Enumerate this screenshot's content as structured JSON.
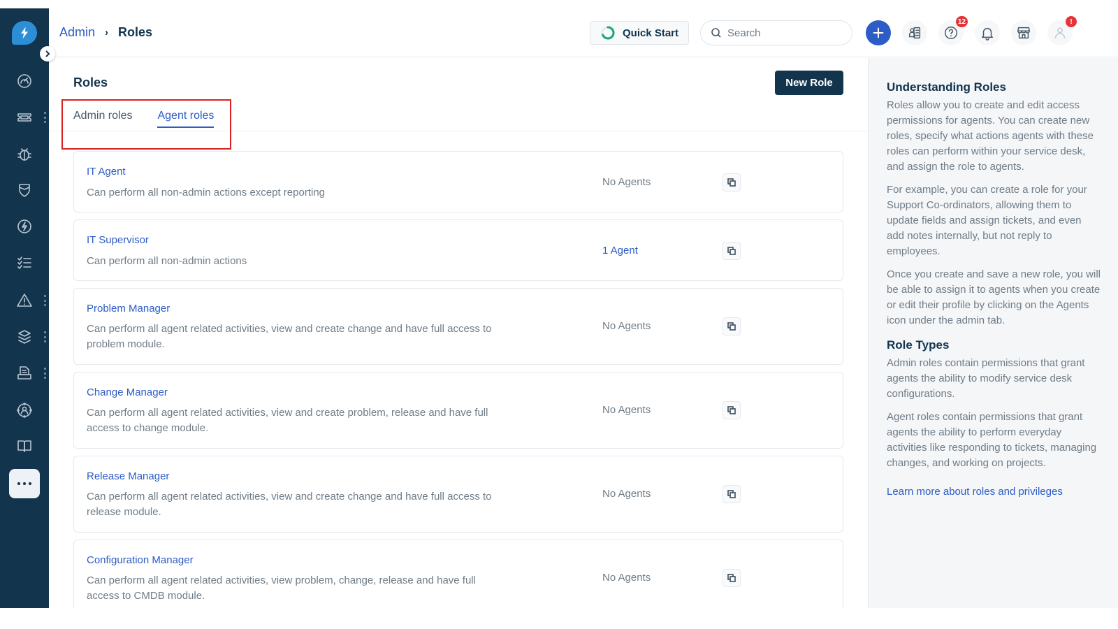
{
  "breadcrumb": {
    "parent": "Admin",
    "current": "Roles"
  },
  "header": {
    "quick_start_label": "Quick Start",
    "search_placeholder": "Search",
    "help_badge": "12",
    "profile_badge": "!"
  },
  "page": {
    "title": "Roles",
    "new_role_label": "New Role",
    "tabs": [
      {
        "label": "Admin roles",
        "active": false
      },
      {
        "label": "Agent roles",
        "active": true
      }
    ]
  },
  "roles": [
    {
      "name": "IT Agent",
      "description": "Can perform all non-admin actions except reporting",
      "agents": "No Agents"
    },
    {
      "name": "IT Supervisor",
      "description": "Can perform all non-admin actions",
      "agents": "1 Agent"
    },
    {
      "name": "Problem Manager",
      "description": "Can perform all agent related activities, view and create change and have full access to problem module.",
      "agents": "No Agents"
    },
    {
      "name": "Change Manager",
      "description": "Can perform all agent related activities, view and create problem, release and have full access to change module.",
      "agents": "No Agents"
    },
    {
      "name": "Release Manager",
      "description": "Can perform all agent related activities, view and create change and have full access to release module.",
      "agents": "No Agents"
    },
    {
      "name": "Configuration Manager",
      "description": "Can perform all agent related activities, view problem, change, release and have full access to CMDB module.",
      "agents": "No Agents"
    }
  ],
  "help": {
    "title": "Understanding Roles",
    "paragraphs": [
      "Roles allow you to create and edit access permissions for agents. You can create new roles, specify what actions agents with these roles can perform within your service desk, and assign the role to agents.",
      "For example, you can create a role for your Support Co-ordinators, allowing them to update fields and assign tickets, and even add notes internally, but not reply to employees.",
      "Once you create and save a new role, you will be able to assign it to agents when you create or edit their profile by clicking on the Agents icon under the admin tab."
    ],
    "types_title": "Role Types",
    "types_paragraphs": [
      "Admin roles contain permissions that grant agents the ability to modify service desk configurations.",
      "Agent roles contain permissions that grant agents the ability to perform everyday activities like responding to tickets, managing changes, and working on projects."
    ],
    "link": "Learn more about roles and privileges"
  },
  "sidebar": {
    "items": [
      {
        "icon": "dashboard-icon"
      },
      {
        "icon": "tickets-icon"
      },
      {
        "icon": "problems-icon"
      },
      {
        "icon": "changes-icon"
      },
      {
        "icon": "releases-icon"
      },
      {
        "icon": "tasks-icon"
      },
      {
        "icon": "alerts-icon"
      },
      {
        "icon": "assets-icon"
      },
      {
        "icon": "contracts-icon"
      },
      {
        "icon": "people-icon"
      },
      {
        "icon": "solutions-icon"
      }
    ]
  },
  "colors": {
    "sidebar_bg": "#12344d",
    "accent": "#2c5cc5",
    "primary_button": "#12344d",
    "badge": "#e43538",
    "highlight": "#d72020"
  }
}
